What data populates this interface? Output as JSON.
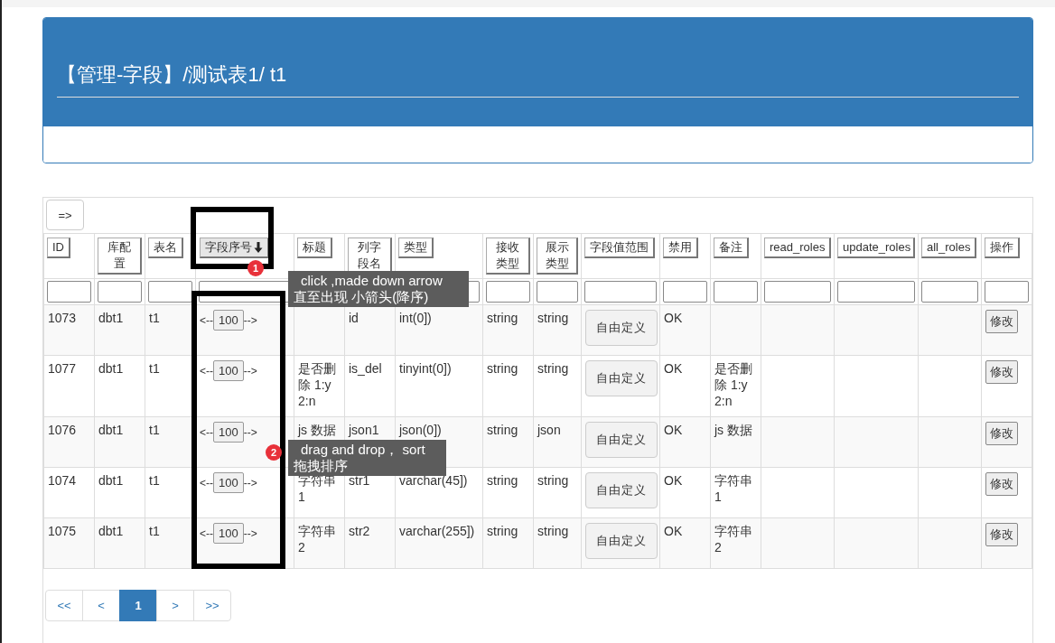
{
  "panel": {
    "title": "【管理-字段】/测试表1/ t1"
  },
  "toolbar": {
    "toggle": "=>"
  },
  "table": {
    "columns": [
      {
        "label": "ID",
        "sorted": false
      },
      {
        "label": "库配置",
        "sorted": false
      },
      {
        "label": "表名",
        "sorted": false
      },
      {
        "label": "字段序号",
        "sorted": true
      },
      {
        "label": "标题",
        "sorted": false
      },
      {
        "label": "列字段名",
        "sorted": false
      },
      {
        "label": "类型",
        "sorted": false
      },
      {
        "label": "接收类型",
        "sorted": false
      },
      {
        "label": "展示类型",
        "sorted": false
      },
      {
        "label": "字段值范围",
        "sorted": false
      },
      {
        "label": "禁用",
        "sorted": false
      },
      {
        "label": "备注",
        "sorted": false
      },
      {
        "label": "read_roles",
        "sorted": false
      },
      {
        "label": "update_roles",
        "sorted": false
      },
      {
        "label": "all_roles",
        "sorted": false
      },
      {
        "label": "操作",
        "sorted": false
      }
    ],
    "rows": [
      {
        "id": "1073",
        "db": "dbt1",
        "table": "t1",
        "prev": "<--",
        "order": "100",
        "next": "-->",
        "column": "id",
        "type": "int(0])",
        "receive": "string",
        "display": "string",
        "range": "自由定义",
        "disabled": "OK",
        "action": "修改"
      },
      {
        "id": "1077",
        "db": "dbt1",
        "table": "t1",
        "prev": "<--",
        "order": "100",
        "next": "-->",
        "title": "是否删除 1:y 2:n",
        "column": "is_del",
        "type": "tinyint(0])",
        "receive": "string",
        "display": "string",
        "range": "自由定义",
        "disabled": "OK",
        "note": "是否删除 1:y 2:n",
        "action": "修改"
      },
      {
        "id": "1076",
        "db": "dbt1",
        "table": "t1",
        "prev": "<--",
        "order": "100",
        "next": "-->",
        "title": "js 数据",
        "column": "json1",
        "type": "json(0])",
        "receive": "string",
        "display": "json",
        "range": "自由定义",
        "disabled": "OK",
        "note": "js 数据",
        "action": "修改"
      },
      {
        "id": "1074",
        "db": "dbt1",
        "table": "t1",
        "prev": "<--",
        "order": "100",
        "next": "-->",
        "title": "字符串 1",
        "column": "str1",
        "type": "varchar(45])",
        "receive": "string",
        "display": "string",
        "range": "自由定义",
        "disabled": "OK",
        "note": "字符串 1",
        "action": "修改"
      },
      {
        "id": "1075",
        "db": "dbt1",
        "table": "t1",
        "prev": "<--",
        "order": "100",
        "next": "-->",
        "title": "字符串 2",
        "column": "str2",
        "type": "varchar(255])",
        "receive": "string",
        "display": "string",
        "range": "自由定义",
        "disabled": "OK",
        "note": "字符串 2",
        "action": "修改"
      }
    ]
  },
  "pagination": [
    {
      "label": "<<",
      "selected": false
    },
    {
      "label": "<",
      "selected": false
    },
    {
      "label": "1",
      "selected": true
    },
    {
      "label": ">",
      "selected": false
    },
    {
      "label": ">>",
      "selected": false
    }
  ],
  "annotations": [
    {
      "number": "1",
      "lines": [
        "click ,made down arrow",
        "直至出现 小箭头(降序)"
      ]
    },
    {
      "number": "2",
      "lines": [
        "drag and drop， sort",
        "拖拽排序"
      ]
    }
  ]
}
